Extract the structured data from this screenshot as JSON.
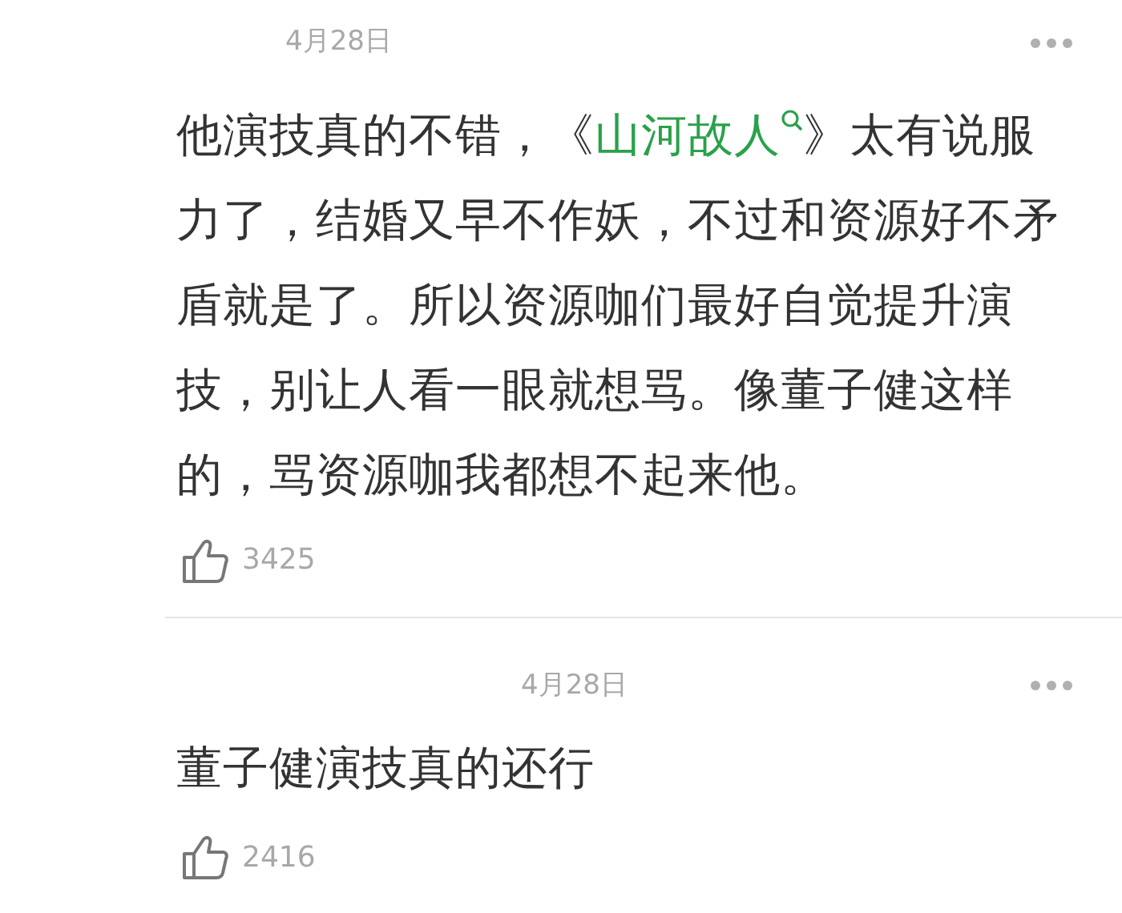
{
  "comments": [
    {
      "date": "4月28日",
      "body": [
        {
          "kind": "plain",
          "text": "他演技真的不错，《"
        },
        {
          "kind": "link",
          "text": "山河故人"
        },
        {
          "kind": "plain",
          "text": "》太有说服力了，结婚又早不作妖，不过和资源好不矛盾就是了。所以资源咖们最好自觉提升演技，别让人看一眼就想骂。像董子健这样的，骂资源咖我都想不起来他。"
        }
      ],
      "likes": "3425"
    },
    {
      "date": "4月28日",
      "body": [
        {
          "kind": "plain",
          "text": "董子健演技真的还行"
        }
      ],
      "likes": "2416"
    }
  ]
}
